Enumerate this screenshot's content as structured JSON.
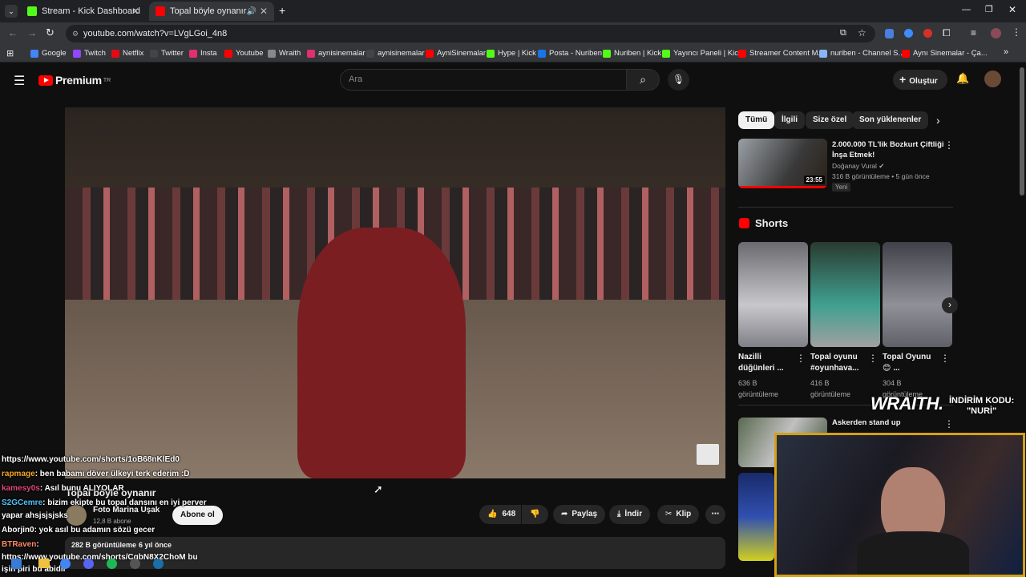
{
  "browser": {
    "tabs": [
      {
        "label": "Stream - Kick Dashboard",
        "color": "#53fc18"
      },
      {
        "label": "Topal böyle oynanır - YouTu",
        "color": "#ff0000"
      }
    ],
    "url": "youtube.com/watch?v=LVgLGoi_4n8",
    "bookmarks": [
      {
        "label": "Google",
        "color": "#4285f4"
      },
      {
        "label": "Twitch",
        "color": "#9146ff"
      },
      {
        "label": "Netflix",
        "color": "#e50914"
      },
      {
        "label": "Twitter",
        "color": "#444"
      },
      {
        "label": "Insta",
        "color": "#e1306c"
      },
      {
        "label": "Youtube",
        "color": "#ff0000"
      },
      {
        "label": "Wraith",
        "color": "#888"
      },
      {
        "label": "aynisinemalar",
        "color": "#e1306c"
      },
      {
        "label": "aynisinemalar",
        "color": "#444"
      },
      {
        "label": "AyniSinemalar",
        "color": "#ff0000"
      },
      {
        "label": "Hype | Kick",
        "color": "#53fc18"
      },
      {
        "label": "Posta - Nuriben",
        "color": "#1a73e8"
      },
      {
        "label": "Nuriben | Kick",
        "color": "#53fc18"
      },
      {
        "label": "Yayıncı Paneli | Kick",
        "color": "#53fc18"
      },
      {
        "label": "Streamer Content M...",
        "color": "#ff0000"
      },
      {
        "label": "nuriben - Channel S...",
        "color": "#8ab4f8"
      },
      {
        "label": "Aynı Sinemalar - Ça...",
        "color": "#ff0000"
      }
    ]
  },
  "youtube": {
    "logo": "Premium",
    "logo_sup": "TR",
    "search_placeholder": "Ara",
    "create_label": "Oluştur",
    "chips": [
      "Tümü",
      "İlgili",
      "Size özel",
      "Son yüklenenler"
    ],
    "video": {
      "title": "Topal böyle oynanır",
      "channel": "Foto Marina Uşak",
      "subs": "12,8 B abone",
      "subscribe": "Abone ol",
      "likes": "648",
      "share": "Paylaş",
      "download": "İndir",
      "clip": "Klip",
      "views": "282 B görüntüleme",
      "age": "6 yıl önce"
    },
    "rec": {
      "title_line1": "2.000.000 TL'lik Bozkurt Çiftliği",
      "title_line2": "İnşa Etmek!",
      "channel": "Doğanay Vural",
      "meta": "316 B görüntüleme • 5 gün önce",
      "badge": "Yeni",
      "duration": "23:55"
    },
    "shorts_title": "Shorts",
    "shorts": [
      {
        "title1": "Nazilli",
        "title2": "düğünleri ...",
        "views1": "636 B",
        "views2": "görüntüleme"
      },
      {
        "title1": "Topal oyunu",
        "title2": "#oyunhava...",
        "views1": "416 B",
        "views2": "görüntüleme"
      },
      {
        "title1": "Topal Oyunu",
        "title2": "😊 ...",
        "views1": "304 B",
        "views2": "görüntüleme"
      }
    ],
    "rec2_title": "Askerden stand up"
  },
  "overlay": {
    "sponsor": "WRAITH.",
    "code_label": "İNDİRİM KODU:",
    "code_value": "\"NURİ\"",
    "chat": [
      {
        "user": "",
        "text": "https://www.youtube.com/shorts/1oB68nKlEd0",
        "color": "#ffffff"
      },
      {
        "user": "rapmage",
        "text": ": ben babamı döver ülkeyi terk ederim :D",
        "color": "#f5a623"
      },
      {
        "user": "kamesy0s",
        "text": ": Asıl bunu ALIYOLAR",
        "color": "#e0457b"
      },
      {
        "user": "S2GCemre",
        "text": ": bizim ekipte bu topal dansını en iyi perver",
        "color": "#4fc3f7"
      },
      {
        "user": "",
        "text": "yapar ahsjsjsjsks",
        "color": "#ffffff"
      },
      {
        "user": "Aborjin0",
        "text": ": yok asıl bu adamın sözü gecer",
        "color": "#ffffff"
      },
      {
        "user": "BTRaven",
        "text": ":",
        "color": "#ff8a65"
      },
      {
        "user": "",
        "text": "https://www.youtube.com/shorts/CqbN8X2ChoM bu",
        "color": "#ffffff"
      },
      {
        "user": "",
        "text": "işin piri bu abidir",
        "color": "#ffffff"
      }
    ]
  }
}
